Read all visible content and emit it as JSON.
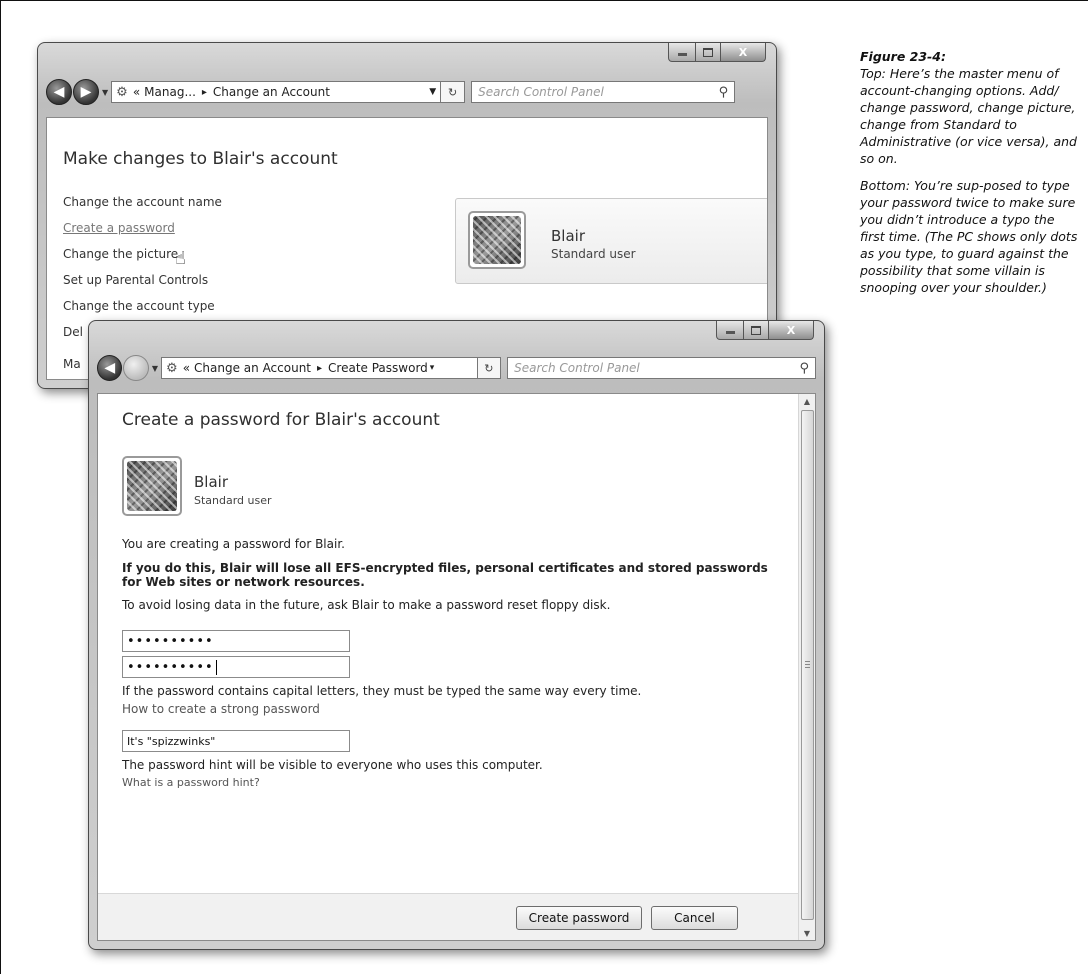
{
  "figure": {
    "label": "Figure 23-4:",
    "caption_top": "Top: Here’s the master menu of account-changing options. Add/ change password, change picture, change from Standard to Administrative (or vice versa), and so on.",
    "caption_bottom": "Bottom: You’re sup-posed to type your password twice to make sure you didn’t introduce a typo the first time. (The PC shows only dots as you type, to guard against the possibility that some villain is snooping over your shoulder.)"
  },
  "top_window": {
    "controls": {
      "minimize_icon": "minimize-icon",
      "maximize_icon": "maximize-icon",
      "close_label": "X"
    },
    "nav": {
      "back_icon": "back-arrow-icon",
      "forward_icon": "forward-arrow-icon",
      "refresh_label": "↻"
    },
    "address": {
      "icon": "control-panel-icon",
      "prefix": "«",
      "crumb1": "Manag...",
      "crumb2": "Change an Account"
    },
    "search_placeholder": "Search Control Panel",
    "heading": "Make changes to Blair's account",
    "tasks": [
      "Change the account name",
      "Create a password",
      "Change the picture",
      "Set up Parental Controls",
      "Change the account type",
      "Del",
      "Ma"
    ],
    "account": {
      "name": "Blair",
      "type": "Standard user"
    }
  },
  "bottom_window": {
    "controls": {
      "close_label": "X"
    },
    "address": {
      "icon": "control-panel-icon",
      "prefix": "«",
      "crumb1": "Change an Account",
      "crumb2": "Create Password"
    },
    "refresh_label": "↻",
    "search_placeholder": "Search Control Panel",
    "heading": "Create a password for Blair's account",
    "account": {
      "name": "Blair",
      "type": "Standard user"
    },
    "intro": "You are creating a password for Blair.",
    "warning": "If you do this, Blair will lose all EFS-encrypted files, personal certificates and stored passwords for Web sites or network resources.",
    "advice": "To avoid losing data in the future, ask Blair to make a password reset floppy disk.",
    "password": "••••••••••",
    "confirm_password": "••••••••••",
    "caps_note": "If the password contains capital letters, they must be typed the same way every time.",
    "strong_link": "How to create a strong password",
    "hint_value": "It's \"spizzwinks\"",
    "hint_note": "The password hint will be visible to everyone who uses this computer.",
    "hint_link": "What is a password hint?",
    "create_button": "Create password",
    "cancel_button": "Cancel"
  }
}
